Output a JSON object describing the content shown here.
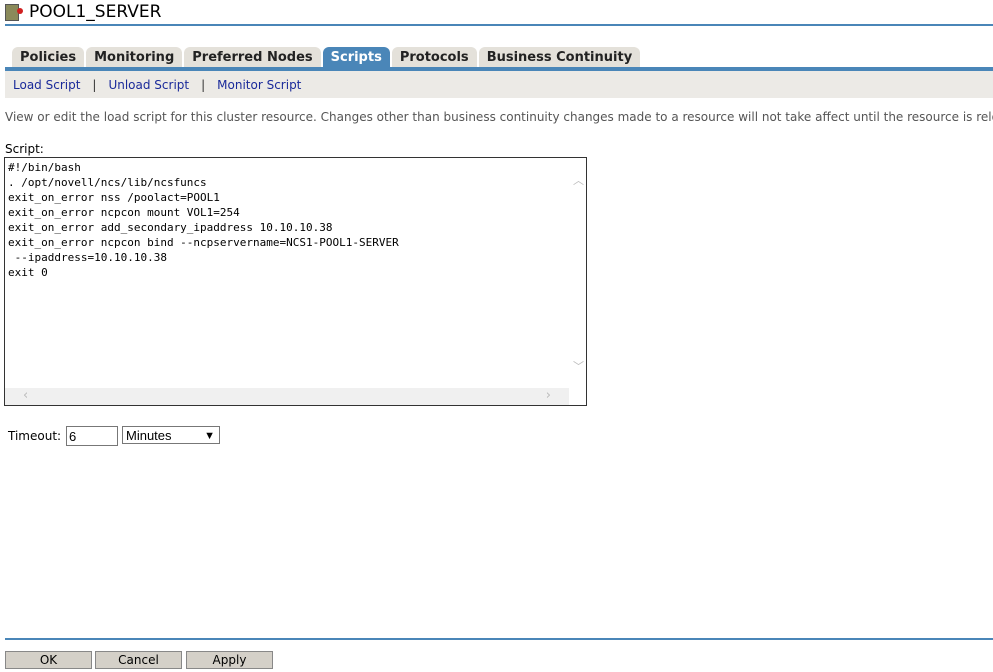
{
  "header": {
    "title": "POOL1_SERVER"
  },
  "tabs": [
    {
      "label": "Policies"
    },
    {
      "label": "Monitoring"
    },
    {
      "label": "Preferred Nodes"
    },
    {
      "label": "Scripts",
      "active": true
    },
    {
      "label": "Protocols"
    },
    {
      "label": "Business Continuity"
    }
  ],
  "subnav": {
    "load": "Load Script",
    "sep": "|",
    "unload": "Unload Script",
    "monitor": "Monitor Script"
  },
  "description": "View or edit the load script for this cluster resource. Changes other than business continuity changes made to a resource will not take affect until the resource is reloaded.",
  "script": {
    "label": "Script:",
    "content": "#!/bin/bash\n. /opt/novell/ncs/lib/ncsfuncs\nexit_on_error nss /poolact=POOL1\nexit_on_error ncpcon mount VOL1=254\nexit_on_error add_secondary_ipaddress 10.10.10.38\nexit_on_error ncpcon bind --ncpservername=NCS1-POOL1-SERVER\n --ipaddress=10.10.10.38\nexit 0"
  },
  "timeout": {
    "label": "Timeout:",
    "value": "6",
    "unit": "Minutes"
  },
  "buttons": {
    "ok": "OK",
    "cancel": "Cancel",
    "apply": "Apply"
  },
  "colors": {
    "accent": "#4a86b8",
    "link": "#1a2a9a"
  }
}
